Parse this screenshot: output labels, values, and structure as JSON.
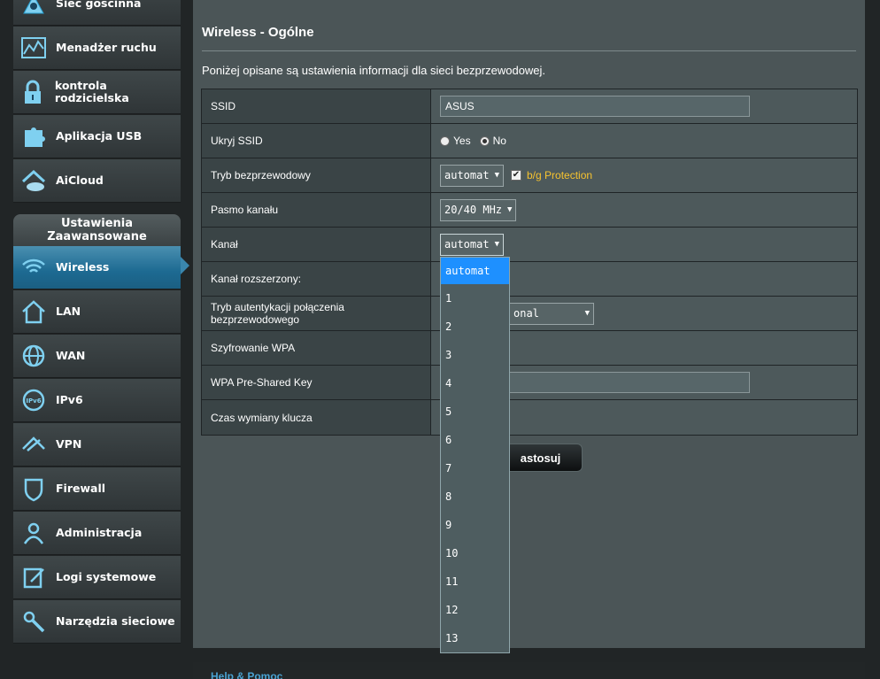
{
  "sidebar": {
    "general_items": [
      {
        "label": "Sieć gościnna",
        "icon": "guest-network-icon"
      },
      {
        "label": "Menadżer ruchu",
        "icon": "traffic-manager-icon"
      },
      {
        "label": "kontrola rodzicielska",
        "icon": "parental-lock-icon"
      },
      {
        "label": "Aplikacja USB",
        "icon": "usb-puzzle-icon"
      },
      {
        "label": "AiCloud",
        "icon": "cloud-house-icon"
      }
    ],
    "advanced_header": "Ustawienia Zaawansowane",
    "advanced_items": [
      {
        "label": "Wireless",
        "icon": "wifi-icon",
        "active": true
      },
      {
        "label": "LAN",
        "icon": "house-icon"
      },
      {
        "label": "WAN",
        "icon": "globe-icon"
      },
      {
        "label": "IPv6",
        "icon": "ipv6-globe-icon"
      },
      {
        "label": "VPN",
        "icon": "vpn-icon"
      },
      {
        "label": "Firewall",
        "icon": "shield-icon"
      },
      {
        "label": "Administracja",
        "icon": "user-icon"
      },
      {
        "label": "Logi systemowe",
        "icon": "log-edit-icon"
      },
      {
        "label": "Narzędzia sieciowe",
        "icon": "wrench-icon"
      }
    ]
  },
  "main": {
    "title": "Wireless - Ogólne",
    "description": "Poniżej opisane są ustawienia informacji dla sieci bezprzewodowej.",
    "fields": {
      "ssid_label": "SSID",
      "ssid_value": "ASUS",
      "hide_ssid_label": "Ukryj SSID",
      "hide_yes": "Yes",
      "hide_no": "No",
      "mode_label": "Tryb bezprzewodowy",
      "mode_value": "automat",
      "bg_protection": "b/g Protection",
      "band_label": "Pasmo kanału",
      "band_value": "20/40 MHz",
      "channel_label": "Kanał",
      "channel_value": "automat",
      "ext_channel_label": "Kanał rozszerzony:",
      "auth_label": "Tryb autentykacji połączenia bezprzewodowego",
      "auth_value": "onal",
      "wpa_enc_label": "Szyfrowanie WPA",
      "wpa_key_label": "WPA Pre-Shared Key",
      "key_rotation_label": "Czas wymiany klucza"
    },
    "apply_button": "astosuj"
  },
  "channel_dropdown": {
    "options": [
      "automat",
      "1",
      "2",
      "3",
      "4",
      "5",
      "6",
      "7",
      "8",
      "9",
      "10",
      "11",
      "12",
      "13"
    ],
    "selected": "automat"
  },
  "footer": {
    "help": "Help & Pomoc"
  },
  "colors": {
    "accent": "#1e90ff",
    "active_nav": "#1d6a92",
    "bg_protection": "#f7c32f"
  }
}
